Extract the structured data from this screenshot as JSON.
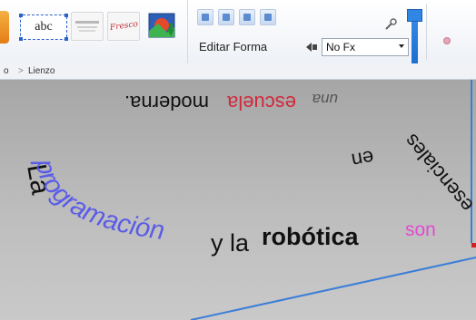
{
  "toolbar": {
    "text_tool": "abc",
    "style_preview_2": "Fresco",
    "edit_shape_label": "Editar Forma",
    "effect_select": {
      "value": "No Fx"
    }
  },
  "breadcrumb": {
    "parent": "o",
    "separator": ">",
    "current": "Lienzo"
  },
  "canvas_text": {
    "top_arc": ".escuela moderna",
    "top_arc_red": "escuela",
    "top_arc_black": "moderna.",
    "top_arc_italic": "una",
    "right_arc_1": "en",
    "right_arc_2": "esenciales",
    "left_word": "La",
    "blue_word": "programación",
    "mid_words": "y la",
    "bold_word": "robótica",
    "pink_word": "son"
  },
  "colors": {
    "accent_blue": "#2f86e3",
    "text_blue": "#5a5ce8",
    "text_red": "#d2283b",
    "text_pink": "#e34ad1",
    "guide_line": "#3b7ed8",
    "marker_red": "#d0201e"
  }
}
